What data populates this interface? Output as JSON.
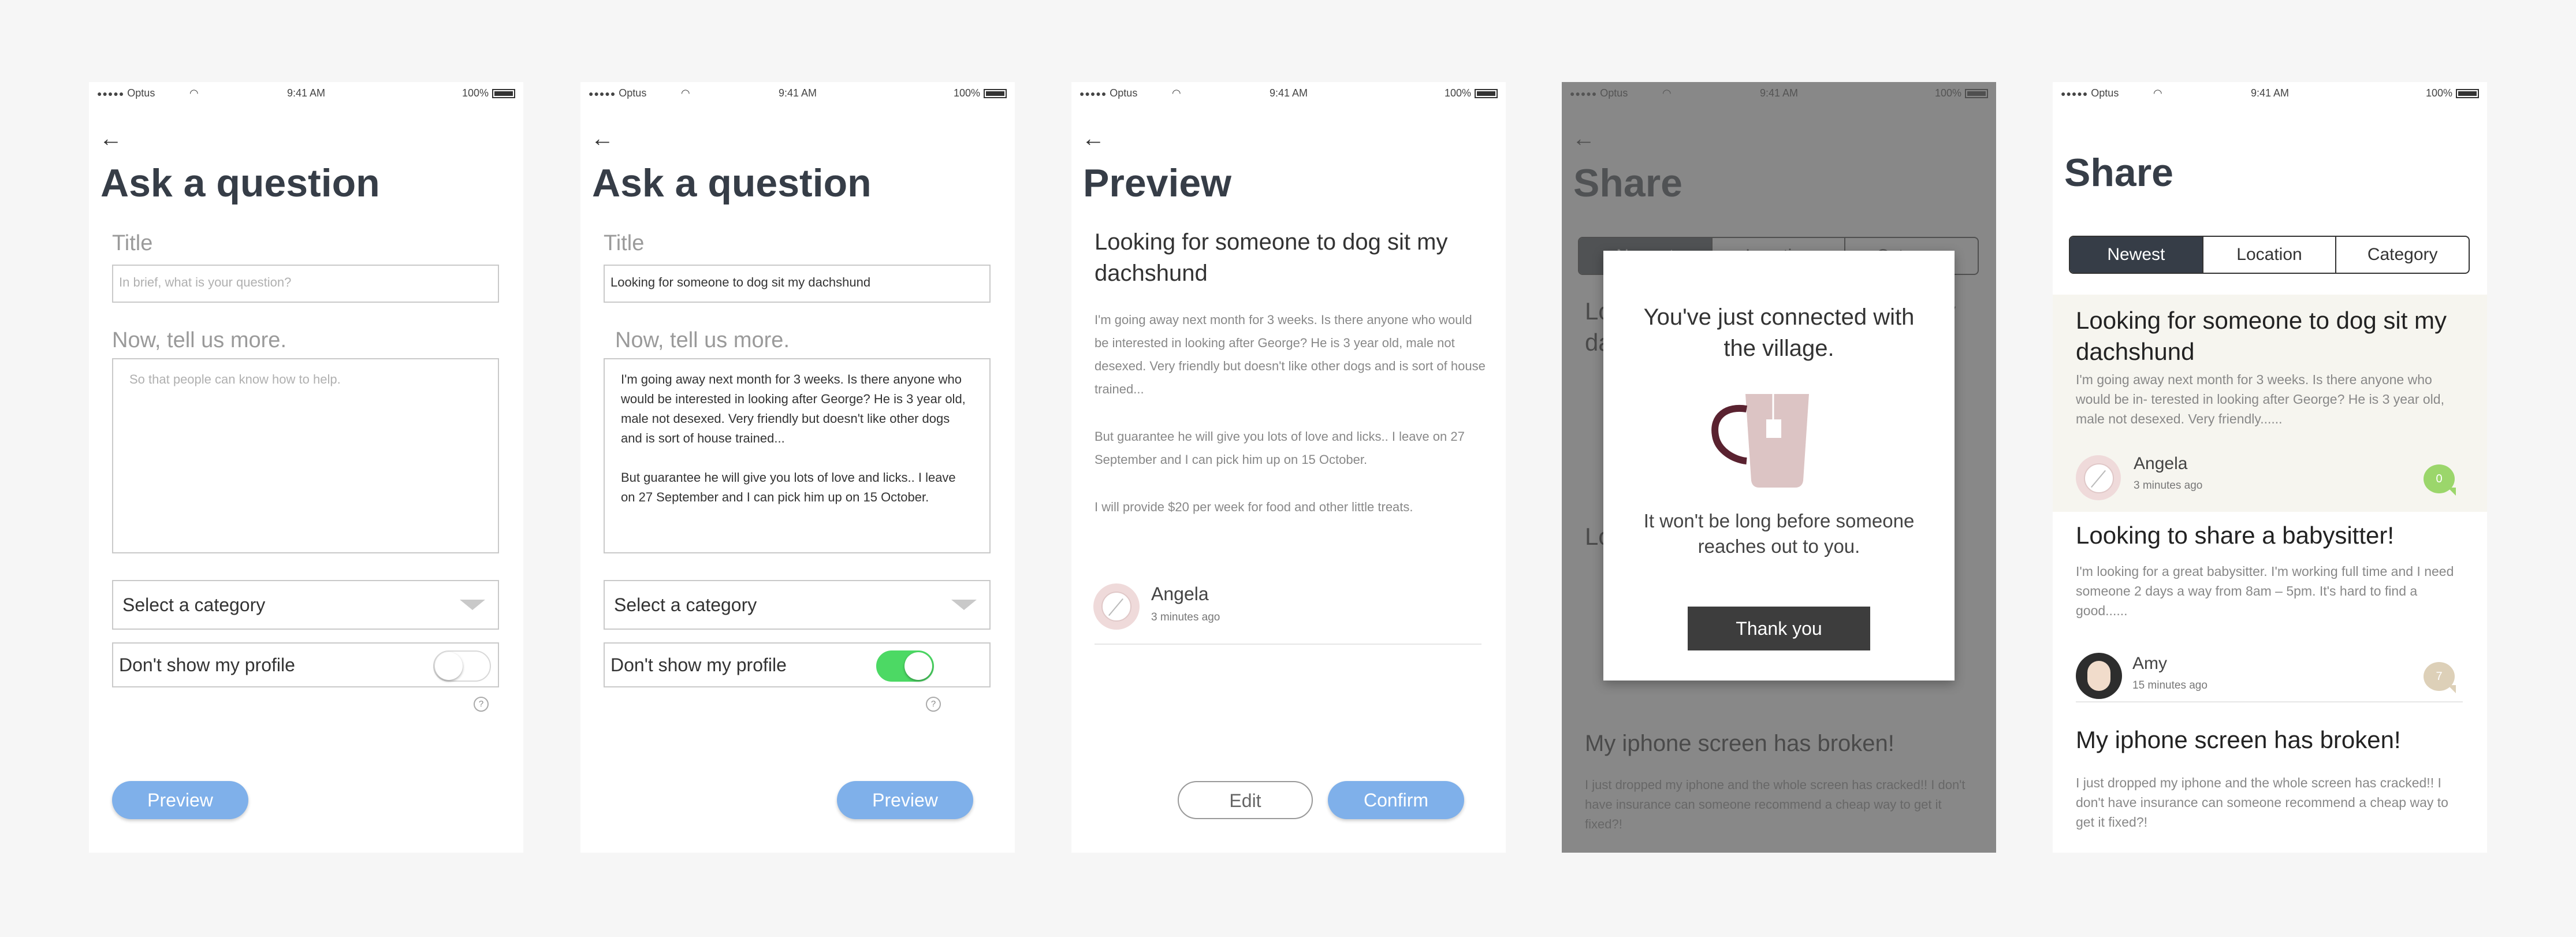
{
  "status": {
    "carrier": "Optus",
    "time": "9:41 AM",
    "battery": "100%"
  },
  "ask": {
    "title": "Ask a question",
    "title_label": "Title",
    "title_placeholder": "In brief, what is your question?",
    "title_value": "Looking for someone to dog sit my dachshund",
    "more_label": "Now, tell us more.",
    "more_placeholder": "So that people can know how to help.",
    "more_value": "I'm going away next month for 3 weeks. Is there anyone who would be interested in looking after George? He is 3 year old, male not desexed. Very friendly but doesn't like other dogs and is sort of house trained...\n\nBut guarantee he will give you lots of love and licks.. I leave on 27 September and I can pick him up on 15 October.",
    "category": "Select a category",
    "hide_profile": "Don't show my profile",
    "help": "?",
    "preview_btn": "Preview"
  },
  "preview": {
    "title": "Preview",
    "post_title": "Looking for someone to dog sit my dachshund",
    "p1": "I'm going away next month for 3 weeks. Is there anyone who would be interested in looking after George? He is 3 year old, male not desexed. Very friendly but doesn't like other dogs and is sort of house trained...",
    "p2": "But guarantee he will give you lots of love and licks.. I leave on 27 September and I can pick him up on 15 October.",
    "p3": "I will provide $20 per week for food and other little treats.",
    "user": "Angela",
    "time": "3 minutes ago",
    "edit": "Edit",
    "confirm": "Confirm"
  },
  "modal": {
    "title": "You've just connected with the village.",
    "body": "It won't be long before someone reaches out to you.",
    "button": "Thank you",
    "icon": "mug-icon"
  },
  "share": {
    "title": "Share",
    "tabs": [
      "Newest",
      "Location",
      "Category"
    ],
    "posts": [
      {
        "title": "Looking for someone to dog sit my dachshund",
        "body": "I'm going away next month for 3 weeks. Is there anyone who would be in- terested in looking after George? He is 3 year old, male not desexed. Very friendly......",
        "user": "Angela",
        "time": "3 minutes ago",
        "count": "0"
      },
      {
        "title": "Looking to share a babysitter!",
        "body": "I'm looking for a great babysitter. I'm working full time and I need someone 2 days a way from 8am – 5pm. It's hard to find a good......",
        "user": "Amy",
        "time": "15 minutes ago",
        "count": "7"
      },
      {
        "title": "My iphone screen has broken!",
        "body": "I just dropped my iphone and the whole screen has cracked!! I don't have insurance can someone recommend a cheap way to get it  fixed?!"
      }
    ]
  },
  "colors": {
    "accent": "#7fb0ea",
    "dark": "#363d47",
    "toggle_on": "#4cd964",
    "bubble_green": "#9bd66b",
    "bubble_tan": "#ddd0b8"
  }
}
